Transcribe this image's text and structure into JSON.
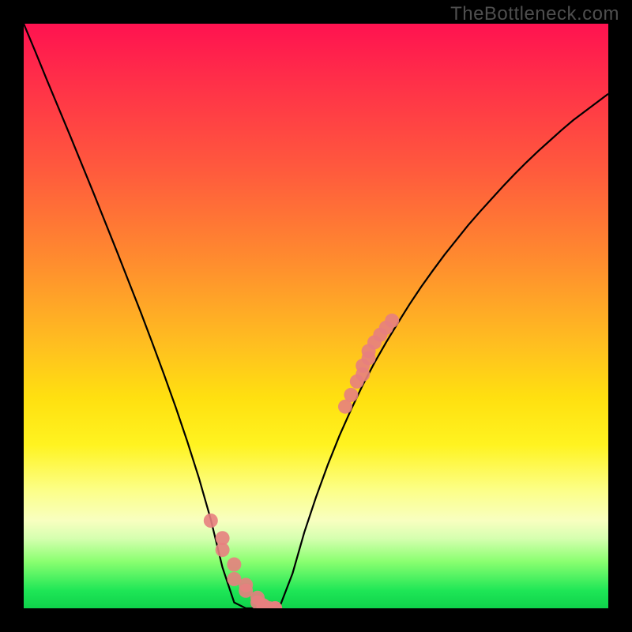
{
  "watermark": "TheBottleneck.com",
  "chart_data": {
    "type": "line",
    "title": "",
    "xlabel": "",
    "ylabel": "",
    "x": [
      0.0,
      0.02,
      0.04,
      0.06,
      0.08,
      0.1,
      0.12,
      0.14,
      0.16,
      0.18,
      0.2,
      0.22,
      0.24,
      0.26,
      0.28,
      0.3,
      0.32,
      0.34,
      0.36,
      0.38,
      0.4,
      0.42,
      0.44,
      0.46,
      0.48,
      0.5,
      0.52,
      0.54,
      0.56,
      0.58,
      0.6,
      0.62,
      0.64,
      0.66,
      0.68,
      0.7,
      0.72,
      0.74,
      0.76,
      0.78,
      0.8,
      0.82,
      0.84,
      0.86,
      0.88,
      0.9,
      0.92,
      0.94,
      0.96,
      0.98,
      1.0
    ],
    "y": [
      1.0,
      0.952,
      0.903,
      0.855,
      0.807,
      0.758,
      0.709,
      0.659,
      0.609,
      0.558,
      0.507,
      0.454,
      0.4,
      0.344,
      0.285,
      0.222,
      0.152,
      0.07,
      0.01,
      0.0,
      0.0,
      0.0,
      0.008,
      0.06,
      0.13,
      0.19,
      0.245,
      0.295,
      0.34,
      0.382,
      0.42,
      0.455,
      0.488,
      0.52,
      0.55,
      0.578,
      0.605,
      0.63,
      0.655,
      0.678,
      0.7,
      0.722,
      0.743,
      0.763,
      0.782,
      0.8,
      0.818,
      0.835,
      0.85,
      0.865,
      0.88
    ],
    "series_markers_x": [
      0.32,
      0.34,
      0.34,
      0.36,
      0.36,
      0.38,
      0.38,
      0.4,
      0.4,
      0.41,
      0.41,
      0.42,
      0.43,
      0.43,
      0.55,
      0.56,
      0.57,
      0.58,
      0.58,
      0.59,
      0.59,
      0.6,
      0.61,
      0.62,
      0.63
    ],
    "series_markers_y": [
      0.15,
      0.12,
      0.1,
      0.075,
      0.05,
      0.04,
      0.03,
      0.018,
      0.01,
      0.005,
      0.003,
      0.0,
      0.0,
      0.0,
      0.345,
      0.365,
      0.388,
      0.4,
      0.415,
      0.428,
      0.44,
      0.455,
      0.468,
      0.48,
      0.492
    ],
    "xlim": [
      0.0,
      1.0
    ],
    "ylim": [
      0.0,
      1.0
    ],
    "gradient_colors": {
      "top": "#ff1250",
      "mid": "#fff320",
      "bottom": "#0fd24b"
    },
    "marker_color": "#e77f7f",
    "line_color": "#000000"
  }
}
